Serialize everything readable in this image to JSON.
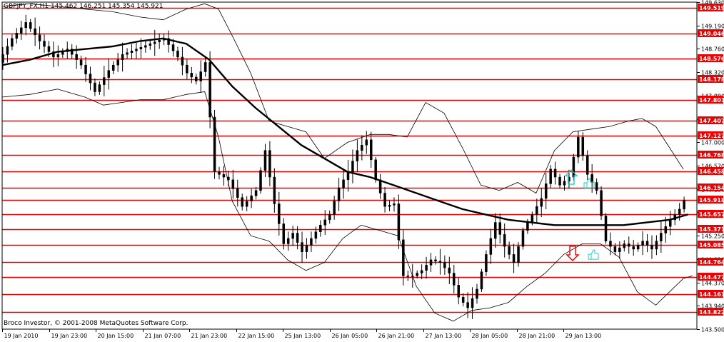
{
  "header": {
    "text": "GBPJPY_FX,H1  145.462 146.251 145.354 145.921"
  },
  "footer": {
    "copyright": "Broco Investor, © 2001-2008 MetaQuotes Software Corp."
  },
  "colors": {
    "background": "#ffffff",
    "grid": "#000000",
    "level_line": "#ee0000",
    "level_label_bg": "#ee0000",
    "level_label_text": "#ffffff",
    "up_signal": "#22cccc",
    "down_signal": "#ee0000"
  },
  "signals": [
    {
      "kind": "up-arrow",
      "icon": "up-arrow-icon",
      "price": 146.35
    },
    {
      "kind": "down-arrow",
      "icon": "down-arrow-icon",
      "price": 144.92
    },
    {
      "kind": "thumbs-up",
      "icon": "thumbs-up-icon",
      "price": 146.23
    },
    {
      "kind": "thumbs-up",
      "icon": "thumbs-up-icon",
      "price": 144.89
    }
  ],
  "chart_data": {
    "type": "candlestick",
    "symbol": "GBPJPY_FX",
    "timeframe": "H1",
    "ohlc_last": {
      "open": 145.462,
      "high": 146.251,
      "low": 145.354,
      "close": 145.921
    },
    "ylim": [
      143.5,
      149.63
    ],
    "y_ticks": [
      149.63,
      149.19,
      148.76,
      148.32,
      147.88,
      147.44,
      147.0,
      146.57,
      146.13,
      145.69,
      145.25,
      144.81,
      144.37,
      143.94,
      143.5
    ],
    "y_tick_labels": [
      "149.630",
      "149.190",
      "148.760",
      "148.320",
      "147.880",
      "147.440",
      "147.000",
      "146.570",
      "146.130",
      "145.690",
      "145.250",
      "144.810",
      "144.370",
      "143.940",
      "143.500"
    ],
    "x_ticks": [
      "19 Jan 2010",
      "19 Jan 23:00",
      "20 Jan 15:00",
      "21 Jan 07:00",
      "21 Jan 23:00",
      "22 Jan 15:00",
      "25 Jan 13:00",
      "26 Jan 05:00",
      "26 Jan 21:00",
      "27 Jan 13:00",
      "28 Jan 05:00",
      "28 Jan 21:00",
      "29 Jan 13:00"
    ],
    "levels": [
      149.519,
      149.046,
      148.576,
      148.178,
      147.801,
      147.407,
      147.127,
      146.768,
      146.458,
      146.154,
      145.918,
      145.657,
      145.371,
      145.085,
      144.764,
      144.477,
      144.161,
      143.822
    ],
    "level_labels": [
      "149.519",
      "149.046",
      "148.576",
      "148.178",
      "147.801",
      "147.407",
      "147.127",
      "146.768",
      "146.458",
      "146.154",
      "145.918",
      "145.657",
      "145.371",
      "145.085",
      "144.764",
      "144.477",
      "144.161",
      "143.822"
    ],
    "close_path": [
      [
        0,
        148.5
      ],
      [
        6,
        148.95
      ],
      [
        12,
        149.25
      ],
      [
        18,
        148.9
      ],
      [
        24,
        148.6
      ],
      [
        30,
        148.75
      ],
      [
        36,
        148.45
      ],
      [
        42,
        147.95
      ],
      [
        48,
        148.35
      ],
      [
        54,
        148.65
      ],
      [
        60,
        148.75
      ],
      [
        66,
        148.85
      ],
      [
        72,
        148.95
      ],
      [
        78,
        148.6
      ],
      [
        82,
        148.3
      ],
      [
        86,
        148.15
      ],
      [
        90,
        148.5
      ],
      [
        94,
        146.45
      ],
      [
        100,
        146.3
      ],
      [
        106,
        145.8
      ],
      [
        112,
        146.1
      ],
      [
        116,
        146.85
      ],
      [
        120,
        145.85
      ],
      [
        124,
        145.1
      ],
      [
        128,
        145.3
      ],
      [
        132,
        144.95
      ],
      [
        136,
        145.2
      ],
      [
        140,
        145.45
      ],
      [
        144,
        145.65
      ],
      [
        148,
        146.15
      ],
      [
        152,
        146.45
      ],
      [
        156,
        146.85
      ],
      [
        160,
        147.05
      ],
      [
        164,
        146.3
      ],
      [
        168,
        145.8
      ],
      [
        172,
        145.85
      ],
      [
        176,
        144.5
      ],
      [
        180,
        144.5
      ],
      [
        184,
        144.6
      ],
      [
        188,
        144.8
      ],
      [
        192,
        144.75
      ],
      [
        196,
        144.55
      ],
      [
        200,
        144.1
      ],
      [
        204,
        143.9
      ],
      [
        208,
        144.25
      ],
      [
        212,
        144.9
      ],
      [
        216,
        145.5
      ],
      [
        220,
        145.05
      ],
      [
        224,
        144.75
      ],
      [
        228,
        145.35
      ],
      [
        232,
        145.65
      ],
      [
        236,
        145.95
      ],
      [
        240,
        146.5
      ],
      [
        244,
        146.2
      ],
      [
        248,
        146.35
      ],
      [
        252,
        147.1
      ],
      [
        256,
        146.4
      ],
      [
        260,
        146.1
      ],
      [
        264,
        145.15
      ],
      [
        268,
        144.95
      ],
      [
        272,
        145.1
      ],
      [
        276,
        145.0
      ],
      [
        280,
        145.15
      ],
      [
        284,
        145.0
      ],
      [
        288,
        145.3
      ],
      [
        292,
        145.55
      ],
      [
        296,
        145.75
      ],
      [
        298,
        145.92
      ]
    ],
    "ma_path": [
      [
        0,
        148.45
      ],
      [
        12,
        148.55
      ],
      [
        24,
        148.7
      ],
      [
        36,
        148.75
      ],
      [
        48,
        148.8
      ],
      [
        60,
        148.9
      ],
      [
        70,
        148.95
      ],
      [
        80,
        148.85
      ],
      [
        90,
        148.55
      ],
      [
        100,
        148.05
      ],
      [
        110,
        147.65
      ],
      [
        120,
        147.3
      ],
      [
        130,
        146.95
      ],
      [
        140,
        146.7
      ],
      [
        150,
        146.45
      ],
      [
        160,
        146.35
      ],
      [
        170,
        146.2
      ],
      [
        180,
        146.05
      ],
      [
        190,
        145.9
      ],
      [
        200,
        145.75
      ],
      [
        210,
        145.65
      ],
      [
        220,
        145.55
      ],
      [
        230,
        145.5
      ],
      [
        240,
        145.45
      ],
      [
        250,
        145.45
      ],
      [
        260,
        145.45
      ],
      [
        270,
        145.45
      ],
      [
        280,
        145.5
      ],
      [
        290,
        145.55
      ],
      [
        298,
        145.65
      ]
    ],
    "band_upper_path": [
      [
        0,
        149.55
      ],
      [
        12,
        149.6
      ],
      [
        24,
        149.55
      ],
      [
        36,
        149.5
      ],
      [
        48,
        149.45
      ],
      [
        60,
        149.35
      ],
      [
        70,
        149.3
      ],
      [
        80,
        149.5
      ],
      [
        88,
        149.6
      ],
      [
        94,
        149.5
      ],
      [
        100,
        149.0
      ],
      [
        108,
        148.3
      ],
      [
        116,
        147.4
      ],
      [
        124,
        147.3
      ],
      [
        132,
        147.2
      ],
      [
        140,
        146.7
      ],
      [
        150,
        147.0
      ],
      [
        160,
        147.15
      ],
      [
        168,
        147.15
      ],
      [
        176,
        147.1
      ],
      [
        184,
        147.75
      ],
      [
        192,
        147.55
      ],
      [
        200,
        146.9
      ],
      [
        208,
        146.2
      ],
      [
        216,
        146.1
      ],
      [
        224,
        146.25
      ],
      [
        232,
        146.05
      ],
      [
        240,
        146.85
      ],
      [
        248,
        147.2
      ],
      [
        256,
        147.25
      ],
      [
        264,
        147.3
      ],
      [
        272,
        147.4
      ],
      [
        278,
        147.45
      ],
      [
        284,
        147.3
      ],
      [
        290,
        146.9
      ],
      [
        296,
        146.5
      ]
    ],
    "band_lower_path": [
      [
        0,
        147.85
      ],
      [
        12,
        147.9
      ],
      [
        24,
        148.0
      ],
      [
        36,
        147.85
      ],
      [
        44,
        147.7
      ],
      [
        52,
        147.75
      ],
      [
        60,
        147.8
      ],
      [
        70,
        147.8
      ],
      [
        80,
        147.9
      ],
      [
        88,
        147.95
      ],
      [
        94,
        147.1
      ],
      [
        100,
        145.9
      ],
      [
        108,
        145.25
      ],
      [
        116,
        145.15
      ],
      [
        124,
        144.8
      ],
      [
        132,
        144.6
      ],
      [
        140,
        144.75
      ],
      [
        148,
        145.2
      ],
      [
        156,
        145.45
      ],
      [
        164,
        145.35
      ],
      [
        172,
        145.25
      ],
      [
        180,
        144.3
      ],
      [
        188,
        143.8
      ],
      [
        196,
        143.65
      ],
      [
        204,
        143.85
      ],
      [
        212,
        143.9
      ],
      [
        220,
        144.0
      ],
      [
        228,
        144.3
      ],
      [
        236,
        144.55
      ],
      [
        244,
        144.9
      ],
      [
        252,
        145.1
      ],
      [
        260,
        145.1
      ],
      [
        268,
        144.85
      ],
      [
        276,
        144.2
      ],
      [
        284,
        143.95
      ],
      [
        290,
        144.2
      ],
      [
        296,
        144.45
      ],
      [
        300,
        144.5
      ]
    ],
    "grid": false,
    "y_axis_position": "right"
  }
}
